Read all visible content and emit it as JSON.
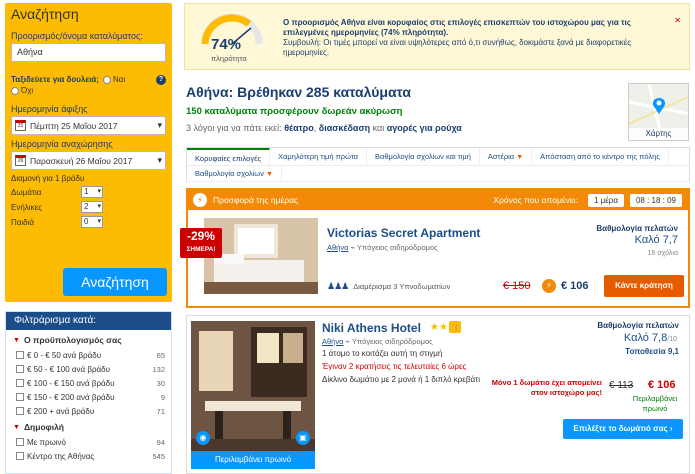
{
  "search": {
    "title": "Αναζήτηση",
    "dest_label": "Προορισμός/όνομα καταλύματος:",
    "dest_value": "Αθήνα",
    "business_label": "Ταξιδεύετε για δουλειά;",
    "yes": "Ναι",
    "no": "Όχι",
    "checkin_label": "Ημερομηνία άφιξης",
    "checkin_value": "Πέμπτη 25 Μαΐου 2017",
    "checkin_day": "25",
    "checkout_label": "Ημερομηνία αναχώρησης",
    "checkout_value": "Παρασκευή 26 Μαΐου 2017",
    "checkout_day": "26",
    "stay": "Διαμονή για 1 βράδυ",
    "rooms_label": "Δωμάτια",
    "rooms": "1",
    "adults_label": "Ενήλικες",
    "adults": "2",
    "children_label": "Παιδιά",
    "children": "0",
    "button": "Αναζήτηση"
  },
  "filters": {
    "title": "Φιλτράρισμα κατά:",
    "budget_title": "Ο προϋπολογισμός σας",
    "budget": [
      {
        "label": "€ 0 - € 50 ανά βράδυ",
        "count": "65"
      },
      {
        "label": "€ 50 - € 100 ανά βράδυ",
        "count": "132"
      },
      {
        "label": "€ 100 - € 150 ανά βράδυ",
        "count": "30"
      },
      {
        "label": "€ 150 - € 200 ανά βράδυ",
        "count": "9"
      },
      {
        "label": "€ 200 + ανά βράδυ",
        "count": "71"
      }
    ],
    "popular_title": "Δημοφιλή",
    "popular": [
      {
        "label": "Με πρωινό",
        "count": "94"
      },
      {
        "label": "Κέντρο της Αθήνας",
        "count": "545"
      }
    ]
  },
  "banner": {
    "percent": "74%",
    "percent_label": "πληρότητα",
    "bold": "Ο προορισμός Αθήνα είναι κορυφαίος στις επιλογές επισκεπτών του ιστοχώρου μας για τις επιλεγμένες ημερομηνίες (74% πληρότητα).",
    "advice": "Συμβουλή: Οι τιμές μπορεί να είναι υψηλότερες από ό,τι συνήθως, δοκιμάστε ξανά με διαφορετικές ημερομηνίες.",
    "close": "✕"
  },
  "results": {
    "heading": "Αθήνα: Βρέθηκαν 285 καταλύματα",
    "free_cancel": "150 καταλύματα προσφέρουν δωρεάν ακύρωση",
    "reasons_prefix": "3 λόγοι για να πάτε εκεί:",
    "reason1": "θέατρο",
    "reason2": "διασκέδαση",
    "and": "και",
    "reason3": "αγορές για ρούχα"
  },
  "map": {
    "label": "Χάρτης"
  },
  "tabs": [
    "Κορυφαίες επιλογές",
    "Χαμηλότερη τιμή πρώτα",
    "Βαθμολογία σχολίων και τιμή",
    "Αστέρια",
    "Απόσταση από το κέντρο της πόλης",
    "Βαθμολογία σχολίων"
  ],
  "deal": {
    "bar_label": "Προσφορά της ημέρας",
    "remaining_label": "Χρόνος που απομένει:",
    "days": "1 μέρα",
    "time": "08 : 18 : 09",
    "discount": "-29%",
    "today": "ΣΗΜΕΡΑ!",
    "name": "Victorias Secret Apartment",
    "city": "Αθήνα",
    "station": "Υπόγειος σιδηρόδρομος",
    "rating_label": "Βαθμολογία πελατών",
    "rating": "Καλό 7,7",
    "reviews": "16 σχόλια",
    "unit": "Διαμέρισμα 3 Υπνοδωματίων",
    "old_price": "€ 150",
    "new_price": "€ 106",
    "book": "Κάντε κράτηση"
  },
  "hotel2": {
    "name": "Niki Athens Hotel",
    "city": "Αθήνα",
    "station": "Υπόγειος σιδηρόδρομος",
    "viewing": "1 άτομο το κοιτάζει αυτή τη στιγμή",
    "booked": "Έγιναν 2 κρατήσεις τις τελευταίες 6 ώρες",
    "room": "Δίκλινο δωμάτιο με 2 μονά ή 1 διπλό κρεβάτι",
    "rating_label": "Βαθμολογία πελατών",
    "rating": "Καλό 7,8",
    "rating_max": "/10",
    "location": "Τοποθεσία 9,1",
    "last_room": "Μόνο 1 δωμάτιο έχει απομείνει στον ιστοχώρο μας!",
    "old_price": "€ 113",
    "new_price": "€ 106",
    "breakfast": "Περιλαμβάνει πρωινό",
    "photo_breakfast": "Περιλαμβάνει πρωινό",
    "choose": "Επιλέξτε το δωμάτιό σας"
  },
  "colors": {
    "accent": "#fdbb02",
    "brand": "#1b4d8a",
    "deal": "#f28a08",
    "cta": "#0896ff"
  }
}
